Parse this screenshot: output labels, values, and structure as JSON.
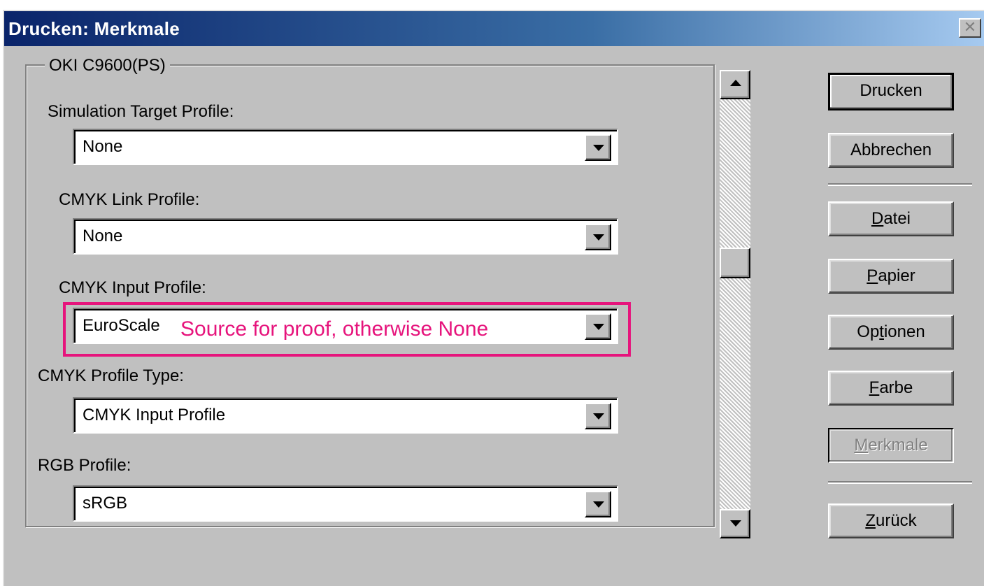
{
  "window": {
    "title": "Drucken: Merkmale",
    "close_label": "✕"
  },
  "group": {
    "legend": "OKI C9600(PS)"
  },
  "fields": [
    {
      "label": "Simulation Target Profile:",
      "value": "None"
    },
    {
      "label": "CMYK Link Profile:",
      "value": "None"
    },
    {
      "label": "CMYK Input Profile:",
      "value": "EuroScale"
    },
    {
      "label": "CMYK Profile Type:",
      "value": "CMYK Input Profile"
    },
    {
      "label": "RGB Profile:",
      "value": "sRGB"
    }
  ],
  "annotation": {
    "text": "Source for proof, otherwise None",
    "color": "#e6147c"
  },
  "buttons": {
    "print": "Drucken",
    "cancel": "Abbrechen",
    "file_mn": "D",
    "file_rest": "atei",
    "paper_mn": "P",
    "paper_rest": "apier",
    "options_pre": "Op",
    "options_mn": "t",
    "options_rest": "ionen",
    "color_mn": "F",
    "color_rest": "arbe",
    "features_mn": "M",
    "features_rest": "erkmale",
    "back_mn": "Z",
    "back_rest": "urück"
  },
  "colors": {
    "titlebar_start": "#0a246a",
    "face": "#c0c0c0"
  }
}
